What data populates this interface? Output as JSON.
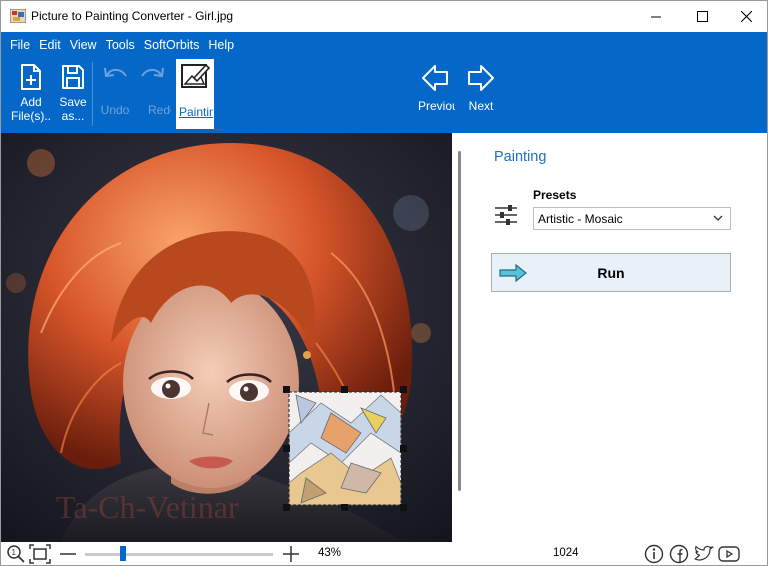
{
  "window": {
    "title": "Picture to Painting Converter - Girl.jpg"
  },
  "menu": {
    "items": [
      {
        "label": "File"
      },
      {
        "label": "Edit"
      },
      {
        "label": "View"
      },
      {
        "label": "Tools"
      },
      {
        "label": "SoftOrbits"
      },
      {
        "label": "Help"
      }
    ]
  },
  "toolbar": {
    "add_files": {
      "line1": "Add",
      "line2": "File(s)..",
      "icon": "add-file-icon"
    },
    "save_as": {
      "line1": "Save",
      "line2": "as...",
      "icon": "save-icon"
    },
    "undo": {
      "label": "Undo",
      "icon": "undo-icon",
      "enabled": false
    },
    "redo": {
      "label": "Redo",
      "icon": "redo-icon",
      "enabled": false
    },
    "painting": {
      "label": "Painting",
      "icon": "painting-icon",
      "active": true
    },
    "previous": {
      "label": "Previous",
      "icon": "arrow-left-icon"
    },
    "next": {
      "label": "Next",
      "icon": "arrow-right-icon"
    }
  },
  "canvas": {
    "watermark": "Ta-Ch-Vetinar"
  },
  "panel": {
    "title": "Painting",
    "presets_label": "Presets",
    "presets_value": "Artistic - Mosaic",
    "run_label": "Run"
  },
  "status": {
    "zoom": "43%",
    "zoom_fraction": 0.2,
    "resolution": "1024"
  },
  "colors": {
    "accent": "#0567c8",
    "panel_title": "#1a73c7"
  }
}
